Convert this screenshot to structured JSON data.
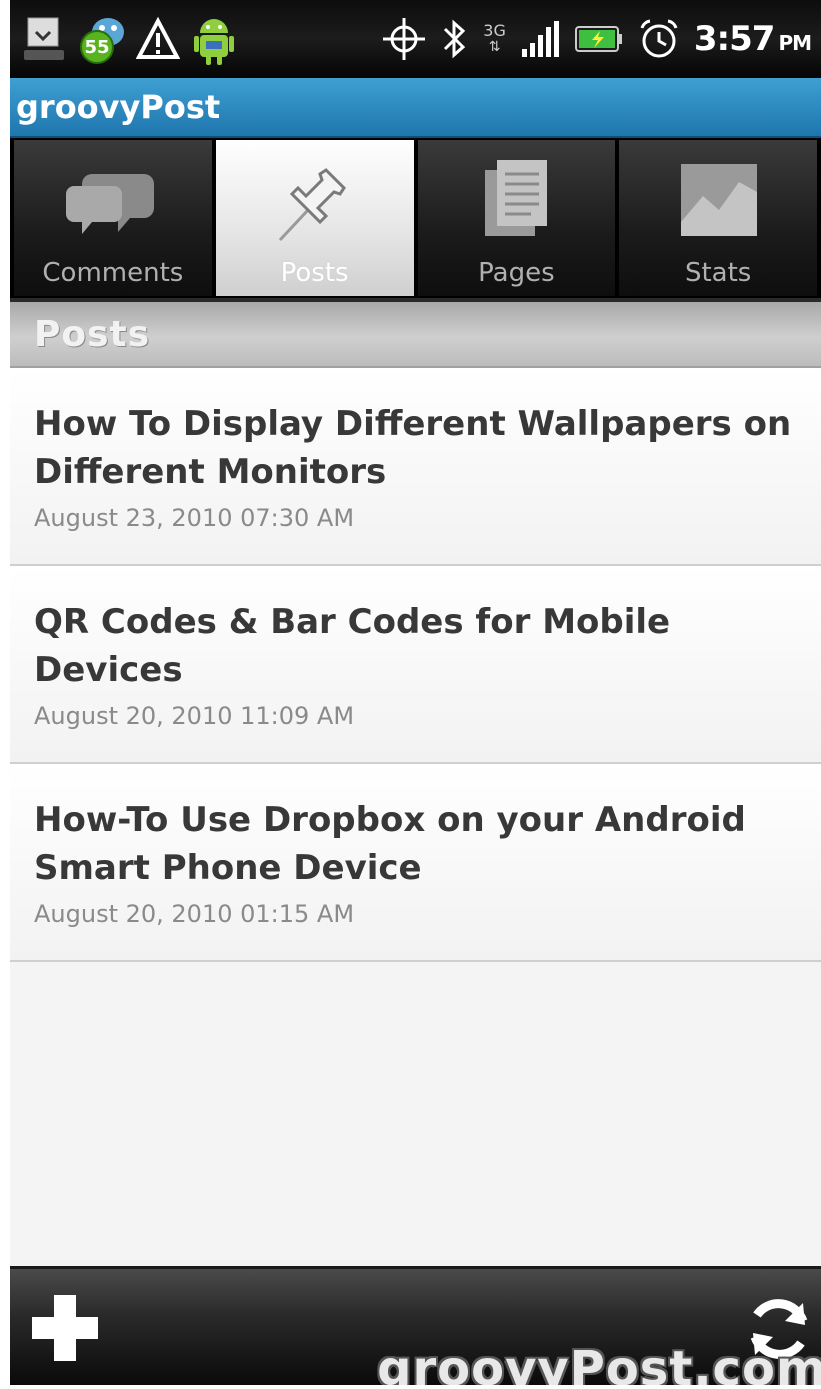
{
  "status_bar": {
    "notification_count": "55",
    "network": "3G",
    "time": "3:57",
    "ampm": "PM",
    "icons": [
      "download-icon",
      "android-badge-icon",
      "warning-icon",
      "android-icon",
      "gps-icon",
      "bluetooth-icon",
      "network-3g-icon",
      "signal-icon",
      "battery-icon",
      "alarm-icon"
    ]
  },
  "app": {
    "title": "groovyPost"
  },
  "tabs": [
    {
      "label": "Comments",
      "icon": "comments-icon",
      "active": false
    },
    {
      "label": "Posts",
      "icon": "pushpin-icon",
      "active": true
    },
    {
      "label": "Pages",
      "icon": "pages-icon",
      "active": false
    },
    {
      "label": "Stats",
      "icon": "stats-icon",
      "active": false
    }
  ],
  "section": {
    "title": "Posts"
  },
  "posts": [
    {
      "title": "How To Display Different Wallpapers on Different Monitors",
      "date": "August 23, 2010 07:30 AM"
    },
    {
      "title": "QR Codes & Bar Codes for Mobile Devices",
      "date": "August 20, 2010 11:09 AM"
    },
    {
      "title": "How-To Use Dropbox on your Android Smart Phone Device",
      "date": "August 20, 2010 01:15 AM"
    }
  ],
  "bottom_bar": {
    "add_icon": "plus-icon",
    "refresh_icon": "refresh-icon"
  },
  "watermark": "groovyPost.com",
  "colors": {
    "title_bar": "#2a86bf",
    "post_title": "#383838",
    "post_date": "#8a8a8a"
  }
}
